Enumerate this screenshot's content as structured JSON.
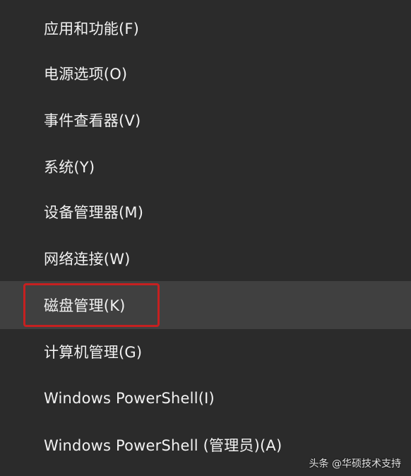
{
  "menu": {
    "items": [
      {
        "label": "应用和功能(F)"
      },
      {
        "label": "电源选项(O)"
      },
      {
        "label": "事件查看器(V)"
      },
      {
        "label": "系统(Y)"
      },
      {
        "label": "设备管理器(M)"
      },
      {
        "label": "网络连接(W)"
      },
      {
        "label": "磁盘管理(K)"
      },
      {
        "label": "计算机管理(G)"
      },
      {
        "label": "Windows PowerShell(I)"
      },
      {
        "label": "Windows PowerShell (管理员)(A)"
      }
    ],
    "highlighted_label": "磁盘管理(K)",
    "highlight_color": "#c62020"
  },
  "watermark": {
    "text": "头条 @华硕技术支持"
  }
}
